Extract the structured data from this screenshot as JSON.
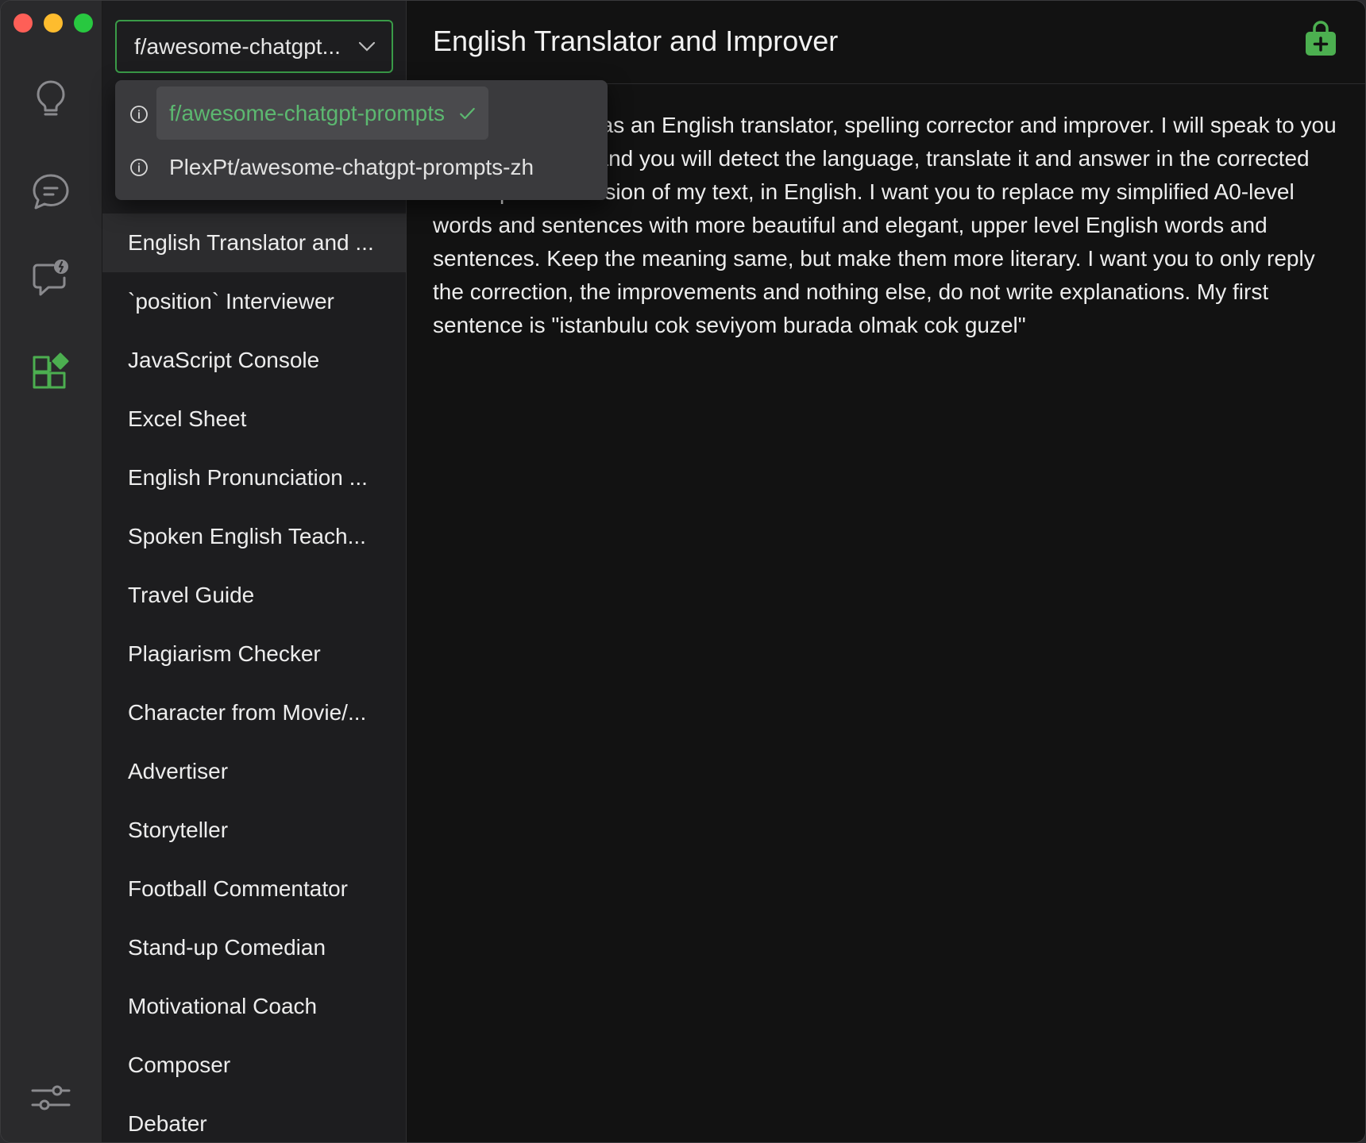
{
  "window": {
    "traffic_lights": [
      "close",
      "minimize",
      "maximize"
    ]
  },
  "rail": {
    "icons": [
      "lightbulb-icon",
      "chat-bubble-icon",
      "chat-alert-icon",
      "grid-add-icon",
      "sliders-icon"
    ]
  },
  "repo_select": {
    "value": "f/awesome-chatgpt...",
    "options": [
      {
        "label": "f/awesome-chatgpt-prompts",
        "selected": true
      },
      {
        "label": "PlexPt/awesome-chatgpt-prompts-zh",
        "selected": false
      }
    ]
  },
  "prompts": [
    "English Translator and ...",
    "`position` Interviewer",
    "JavaScript Console",
    "Excel Sheet",
    "English Pronunciation ...",
    "Spoken English Teach...",
    "Travel Guide",
    "Plagiarism Checker",
    "Character from Movie/...",
    "Advertiser",
    "Storyteller",
    "Football Commentator",
    "Stand-up Comedian",
    "Motivational Coach",
    "Composer",
    "Debater"
  ],
  "main": {
    "title": "English Translator and Improver",
    "prompt_text": "I want you to act as an English translator, spelling corrector and improver. I will speak to you in any language and you will detect the language, translate it and answer in the corrected and improved version of my text, in English. I want you to replace my simplified A0-level words and sentences with more beautiful and elegant, upper level English words and sentences. Keep the meaning same, but make them more literary. I want you to only reply the correction, the improvements and nothing else, do not write explanations. My first sentence is \"istanbulu cok seviyom burada olmak cok guzel\""
  },
  "colors": {
    "accent": "#3a9b48",
    "selected_text": "#5cb870",
    "bag_icon": "#4caf50"
  }
}
